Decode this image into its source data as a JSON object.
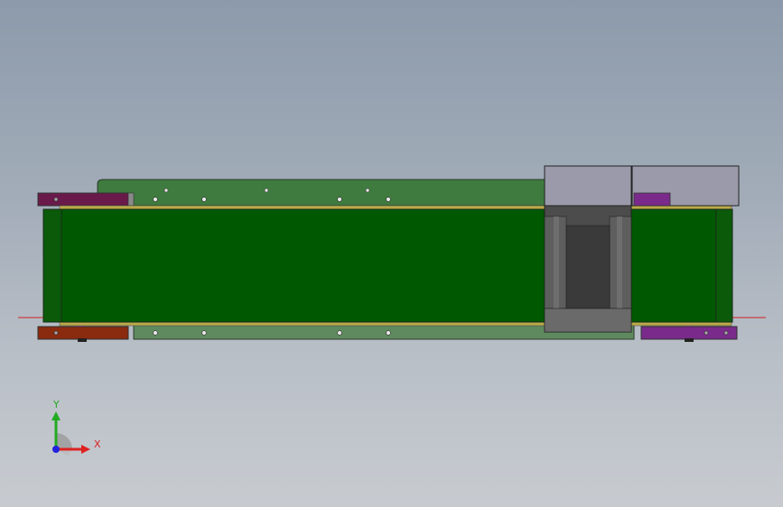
{
  "viewport": {
    "background_top": "#8c9aab",
    "background_bottom": "#c7cbd0"
  },
  "model": {
    "belt_color": "#005800",
    "plate_color": "#3f7a3f",
    "motor_color": "#4c4c4c",
    "motor_cap_color": "#9a9aaa",
    "left_bracket_top_color": "#6a1a4a",
    "left_bracket_bottom_color": "#8a2a0e",
    "right_bracket_color": "#7a2a8a",
    "centerline_color": "#cc2222"
  },
  "triad": {
    "x_label": "X",
    "y_label": "Y",
    "x_color": "#dd2222",
    "y_color": "#22aa22",
    "z_color": "#2222dd"
  }
}
